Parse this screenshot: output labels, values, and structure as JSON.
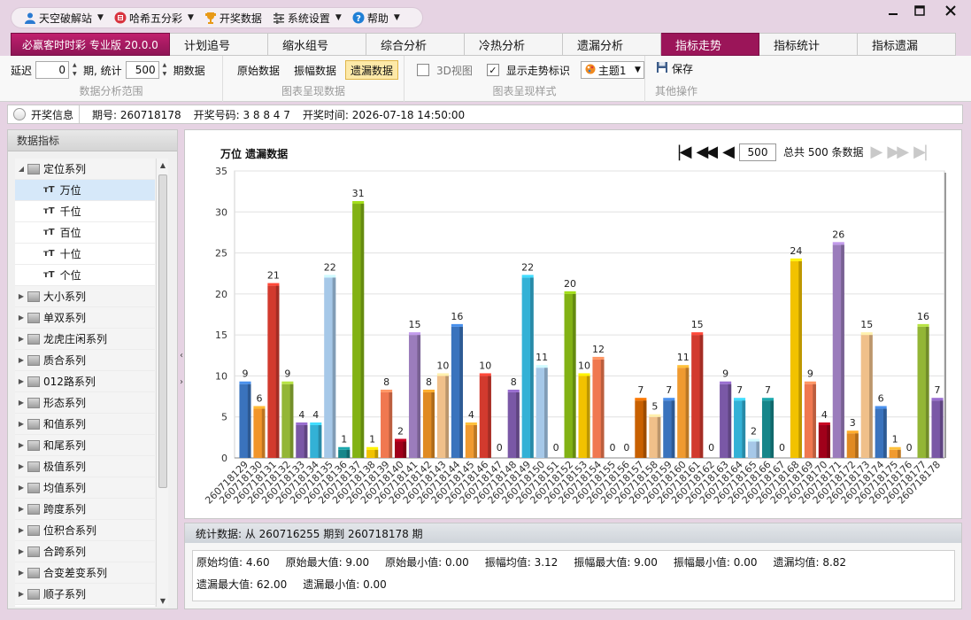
{
  "menu": {
    "items": [
      {
        "label": "天空破解站",
        "icon": "user-icon"
      },
      {
        "label": "哈希五分彩",
        "icon": "lottery-icon"
      },
      {
        "label": "开奖数据",
        "icon": "trophy-icon"
      },
      {
        "label": "系统设置",
        "icon": "settings-icon"
      },
      {
        "label": "帮助",
        "icon": "help-icon"
      }
    ]
  },
  "tabs": [
    {
      "label": "必赢客时时彩 专业版 20.0.0"
    },
    {
      "label": "计划追号"
    },
    {
      "label": "缩水组号"
    },
    {
      "label": "综合分析"
    },
    {
      "label": "冷热分析"
    },
    {
      "label": "遗漏分析"
    },
    {
      "label": "指标走势"
    },
    {
      "label": "指标统计"
    },
    {
      "label": "指标遗漏"
    }
  ],
  "toolbar": {
    "delay_label": "延迟",
    "delay_value": "0",
    "period_unit": "期, 统计",
    "stat_value": "500",
    "stat_unit": "期数据",
    "range_caption": "数据分析范围",
    "btn_raw": "原始数据",
    "btn_amp": "振幅数据",
    "btn_miss": "遗漏数据",
    "display_caption": "图表呈现数据",
    "btn_3d": "3D视图",
    "btn_trend": "显示走势标识",
    "theme": "主题1",
    "style_caption": "图表呈现样式",
    "btn_save": "保存",
    "other_caption": "其他操作"
  },
  "info": {
    "button": "开奖信息",
    "period": "期号: 260718178",
    "numbers": "开奖号码: 3 8 8 4 7",
    "time": "开奖时间: 2026-07-18 14:50:00"
  },
  "sidebar": {
    "title": "数据指标",
    "group_open": "定位系列",
    "children": [
      "万位",
      "千位",
      "百位",
      "十位",
      "个位"
    ],
    "groups": [
      "大小系列",
      "单双系列",
      "龙虎庄闲系列",
      "质合系列",
      "012路系列",
      "形态系列",
      "和值系列",
      "和尾系列",
      "极值系列",
      "均值系列",
      "跨度系列",
      "位积合系列",
      "合跨系列",
      "合变差变系列",
      "顺子系列"
    ]
  },
  "pager": {
    "page_size": "500",
    "total_text": "总共 500 条数据"
  },
  "chart_data": {
    "type": "bar",
    "title": "万位 遗漏数据",
    "xlabel": "",
    "ylabel": "",
    "ylim": [
      0,
      35
    ],
    "yticks": [
      0,
      5,
      10,
      15,
      20,
      25,
      30,
      35
    ],
    "grid": true,
    "categories": [
      "260718129",
      "260718130",
      "260718131",
      "260718132",
      "260718133",
      "260718134",
      "260718135",
      "260718136",
      "260718137",
      "260718138",
      "260718139",
      "260718140",
      "260718141",
      "260718142",
      "260718143",
      "260718144",
      "260718145",
      "260718146",
      "260718147",
      "260718148",
      "260718149",
      "260718150",
      "260718151",
      "260718152",
      "260718153",
      "260718154",
      "260718155",
      "260718156",
      "260718157",
      "260718158",
      "260718159",
      "260718160",
      "260718161",
      "260718162",
      "260718163",
      "260718164",
      "260718165",
      "260718166",
      "260718167",
      "260718168",
      "260718169",
      "260718170",
      "260718171",
      "260718172",
      "260718173",
      "260718174",
      "260718175",
      "260718176",
      "260718177",
      "260718178"
    ],
    "values": [
      9,
      6,
      21,
      9,
      4,
      4,
      22,
      1,
      31,
      1,
      8,
      2,
      15,
      8,
      10,
      16,
      4,
      10,
      0,
      8,
      22,
      11,
      0,
      20,
      10,
      12,
      0,
      0,
      7,
      5,
      7,
      11,
      15,
      0,
      9,
      7,
      2,
      7,
      0,
      24,
      9,
      4,
      26,
      3,
      15,
      6,
      1,
      0,
      16,
      7
    ],
    "colors": [
      "#3a73bd",
      "#f2952a",
      "#d23a2e",
      "#93b636",
      "#7a58a6",
      "#33b1d6",
      "#a6c8e8",
      "#16868a",
      "#82b214",
      "#f2c200",
      "#f07850",
      "#a0001a",
      "#9b7cbc",
      "#e08a22",
      "#f0c08a",
      "#3a73bd",
      "#f09a30",
      "#d23a2e",
      "#93b636",
      "#7a58a6",
      "#33b1d6",
      "#a6c8e8",
      "#16868a",
      "#82b214",
      "#f2c200",
      "#f07850",
      "#a0001a",
      "#9b7cbc",
      "#c86000",
      "#f0c08a",
      "#3a73bd",
      "#f09a30",
      "#d23a2e",
      "#93b636",
      "#7a58a6",
      "#33b1d6",
      "#a6c8e8",
      "#16868a",
      "#82b214",
      "#f2c200",
      "#f07850",
      "#a0001a",
      "#9b7cbc",
      "#e08a22",
      "#f0c08a",
      "#3a73bd",
      "#f09a30",
      "#d23a2e",
      "#93b636",
      "#7a58a6"
    ]
  },
  "stats": {
    "header": "统计数据: 从 260716255 期到 260718178 期",
    "items": [
      "原始均值: 4.60",
      "原始最大值: 9.00",
      "原始最小值: 0.00",
      "振幅均值: 3.12",
      "振幅最大值: 9.00",
      "振幅最小值: 0.00",
      "遗漏均值: 8.82",
      "遗漏最大值: 62.00",
      "遗漏最小值: 0.00"
    ]
  }
}
